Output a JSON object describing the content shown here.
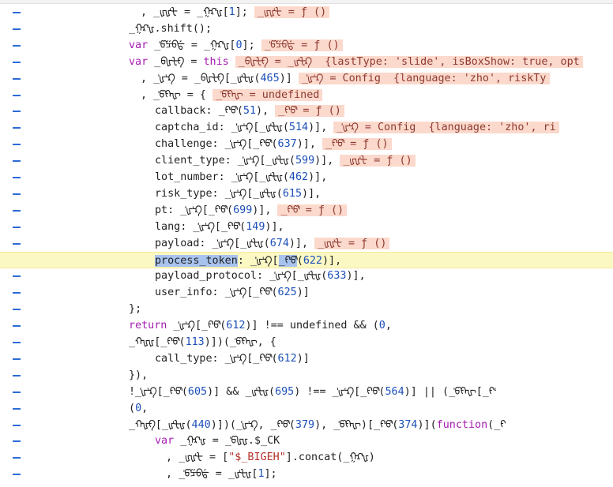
{
  "code_lines": [
    {
      "indent": 178,
      "highlight": false,
      "parts": [
        {
          "t": ", _ᡁᡁᡃᡶ = _ᠭᡘᡃᡁ[",
          "c": ""
        },
        {
          "t": "1",
          "c": "num"
        },
        {
          "t": "];",
          "c": ""
        }
      ],
      "inline": "_ᡁᡁᡃᡶ = ƒ ()"
    },
    {
      "indent": 163,
      "highlight": false,
      "parts": [
        {
          "t": "_ᠭᡘᡃᡁ.shift();",
          "c": ""
        }
      ],
      "inline": ""
    },
    {
      "indent": 163,
      "highlight": false,
      "parts": [
        {
          "t": "var",
          "c": "kw"
        },
        {
          "t": " _ᡃᡦᡸᠪᡩ = _ᠭᡘᡃᡁ[",
          "c": ""
        },
        {
          "t": "0",
          "c": "num"
        },
        {
          "t": "];",
          "c": ""
        }
      ],
      "inline": "_ᡃᡦᡸᠪᡩ = ƒ ()"
    },
    {
      "indent": 163,
      "highlight": false,
      "parts": [
        {
          "t": "var",
          "c": "kw"
        },
        {
          "t": " _ᠪᡁᡶᠻ = ",
          "c": ""
        },
        {
          "t": "this",
          "c": "kw"
        }
      ],
      "inline": "_ᠪᡁᡶᠻ = _ᡁᡃᡶᡘ  {lastType: 'slide', isBoxShow: true, opt"
    },
    {
      "indent": 178,
      "highlight": false,
      "parts": [
        {
          "t": ", _ᡃᡃᡁᡃᡘ = _ᠪᡁᡶᠻ[_ᡁᡃᡶᡁ(",
          "c": ""
        },
        {
          "t": "465",
          "c": "num"
        },
        {
          "t": ")]",
          "c": ""
        }
      ],
      "inline": "_ᡃᡃᡁᡃᡘ = Config  {language: 'zho', riskTy"
    },
    {
      "indent": 178,
      "highlight": false,
      "parts": [
        {
          "t": ", _ᡃᡦᠻᡙ = {",
          "c": ""
        }
      ],
      "inline": "_ᡃᡦᠻᡙ = undefined"
    },
    {
      "indent": 196,
      "highlight": false,
      "parts": [
        {
          "t": "callback: _ᠻᡃᡦᡃ(",
          "c": ""
        },
        {
          "t": "51",
          "c": "num"
        },
        {
          "t": "),",
          "c": ""
        }
      ],
      "inline": "_ᠻᡃᡦᡃ = ƒ ()"
    },
    {
      "indent": 196,
      "highlight": false,
      "parts": [
        {
          "t": "captcha_id: _ᡃᡃᡁᡃᡘ[_ᡁᡃᡶᡁ(",
          "c": ""
        },
        {
          "t": "514",
          "c": "num"
        },
        {
          "t": ")],",
          "c": ""
        }
      ],
      "inline": "_ᡃᡃᡁᡃᡘ = Config  {language: 'zho', ri"
    },
    {
      "indent": 196,
      "highlight": false,
      "parts": [
        {
          "t": "challenge: _ᡃᡃᡁᡃᡘ[_ᠻᡃᡦᡃ(",
          "c": ""
        },
        {
          "t": "637",
          "c": "num"
        },
        {
          "t": ")],",
          "c": ""
        }
      ],
      "inline": "_ᠻᡃᡦᡃ = ƒ ()"
    },
    {
      "indent": 196,
      "highlight": false,
      "parts": [
        {
          "t": "client_type: _ᡃᡃᡁᡃᡘ[_ᡁᡃᡶᡁ(",
          "c": ""
        },
        {
          "t": "599",
          "c": "num"
        },
        {
          "t": ")],",
          "c": ""
        }
      ],
      "inline": "_ᡁᡁᡃᡶ = ƒ ()"
    },
    {
      "indent": 196,
      "highlight": false,
      "parts": [
        {
          "t": "lot_number: _ᡃᡃᡁᡃᡘ[_ᡁᡃᡶᡁ(",
          "c": ""
        },
        {
          "t": "462",
          "c": "num"
        },
        {
          "t": ")],",
          "c": ""
        }
      ],
      "inline": ""
    },
    {
      "indent": 196,
      "highlight": false,
      "parts": [
        {
          "t": "risk_type: _ᡃᡃᡁᡃᡘ[_ᡁᡃᡶᡁ(",
          "c": ""
        },
        {
          "t": "615",
          "c": "num"
        },
        {
          "t": ")],",
          "c": ""
        }
      ],
      "inline": ""
    },
    {
      "indent": 196,
      "highlight": false,
      "parts": [
        {
          "t": "pt: _ᡃᡃᡁᡃᡘ[_ᠻᡃᡦᡃ(",
          "c": ""
        },
        {
          "t": "699",
          "c": "num"
        },
        {
          "t": ")],",
          "c": ""
        }
      ],
      "inline": "_ᠻᡃᡦᡃ = ƒ ()"
    },
    {
      "indent": 196,
      "highlight": false,
      "parts": [
        {
          "t": "lang: _ᡃᡃᡁᡃᡘ[_ᠻᡃᡦᡃ(",
          "c": ""
        },
        {
          "t": "149",
          "c": "num"
        },
        {
          "t": ")],",
          "c": ""
        }
      ],
      "inline": ""
    },
    {
      "indent": 196,
      "highlight": false,
      "parts": [
        {
          "t": "payload: _ᡃᡃᡁᡃᡘ[_ᡁᡃᡶᡁ(",
          "c": ""
        },
        {
          "t": "674",
          "c": "num"
        },
        {
          "t": ")],",
          "c": ""
        }
      ],
      "inline": "_ᡁᡁᡃᡶ = ƒ ()"
    },
    {
      "indent": 196,
      "highlight": true,
      "parts": [
        {
          "t": "process_token",
          "c": "sel"
        },
        {
          "t": ": _ᡃᡃᡁᡃᡘ[",
          "c": ""
        },
        {
          "t": "_ᠻᡃᡦᡃ",
          "c": "sel"
        },
        {
          "t": "(",
          "c": ""
        },
        {
          "t": "622",
          "c": "num"
        },
        {
          "t": ")],",
          "c": ""
        }
      ],
      "inline": ""
    },
    {
      "indent": 196,
      "highlight": false,
      "parts": [
        {
          "t": "payload_protocol: _ᡃᡃᡁᡃᡘ[_ᡁᡃᡶᡁ(",
          "c": ""
        },
        {
          "t": "633",
          "c": "num"
        },
        {
          "t": ")],",
          "c": ""
        }
      ],
      "inline": ""
    },
    {
      "indent": 196,
      "highlight": false,
      "parts": [
        {
          "t": "user_info: _ᡃᡃᡁᡃᡘ[_ᠻᡃᡦᡃ(",
          "c": ""
        },
        {
          "t": "625",
          "c": "num"
        },
        {
          "t": ")]",
          "c": ""
        }
      ],
      "inline": ""
    },
    {
      "indent": 163,
      "highlight": false,
      "parts": [
        {
          "t": "};",
          "c": ""
        }
      ],
      "inline": ""
    },
    {
      "indent": 163,
      "highlight": false,
      "parts": [
        {
          "t": "return",
          "c": "kw"
        },
        {
          "t": " _ᡃᡃᡁᡃᡘ[_ᠻᡃᡦᡃ(",
          "c": ""
        },
        {
          "t": "612",
          "c": "num"
        },
        {
          "t": ")] !== undefined && (",
          "c": ""
        },
        {
          "t": "0",
          "c": "num"
        },
        {
          "t": ",",
          "c": ""
        }
      ],
      "inline": ""
    },
    {
      "indent": 163,
      "highlight": false,
      "parts": [
        {
          "t": "_ᡣᡁᡁ[_ᠻᡃᡦᡃ(",
          "c": ""
        },
        {
          "t": "113",
          "c": "num"
        },
        {
          "t": ")])(_ᡃᡦᠻᡙ, {",
          "c": ""
        }
      ],
      "inline": ""
    },
    {
      "indent": 196,
      "highlight": false,
      "parts": [
        {
          "t": "call_type: _ᡃᡃᡁᡃᡘ[_ᠻᡃᡦᡃ(",
          "c": ""
        },
        {
          "t": "612",
          "c": "num"
        },
        {
          "t": ")]",
          "c": ""
        }
      ],
      "inline": ""
    },
    {
      "indent": 163,
      "highlight": false,
      "parts": [
        {
          "t": "}),",
          "c": ""
        }
      ],
      "inline": ""
    },
    {
      "indent": 163,
      "highlight": false,
      "parts": [
        {
          "t": "!_ᡃᡃᡁᡃᡘ[_ᠻᡃᡦᡃ(",
          "c": ""
        },
        {
          "t": "605",
          "c": "num"
        },
        {
          "t": ")] && _ᡁᡃᡶᡁ(",
          "c": ""
        },
        {
          "t": "695",
          "c": "num"
        },
        {
          "t": ") !== _ᡃᡃᡁᡃᡘ[_ᠻᡃᡦᡃ(",
          "c": ""
        },
        {
          "t": "564",
          "c": "num"
        },
        {
          "t": ")] || (_ᡃᡦᠻᡙ[_ᠻᡃ",
          "c": ""
        }
      ],
      "inline": ""
    },
    {
      "indent": 163,
      "highlight": false,
      "parts": [
        {
          "t": "(",
          "c": ""
        },
        {
          "t": "0",
          "c": "num"
        },
        {
          "t": ",",
          "c": ""
        }
      ],
      "inline": ""
    },
    {
      "indent": 163,
      "highlight": false,
      "parts": [
        {
          "t": "_ᡣᡁᠻ[_ᡁᡃᡶᡁ(",
          "c": ""
        },
        {
          "t": "440",
          "c": "num"
        },
        {
          "t": ")])(_ᡃᡃᡁᡃᡘ, _ᠻᡃᡦᡃ(",
          "c": ""
        },
        {
          "t": "379",
          "c": "num"
        },
        {
          "t": "), _ᡃᡦᠻᡙ)[_ᠻᡃᡦᡃ(",
          "c": ""
        },
        {
          "t": "374",
          "c": "num"
        },
        {
          "t": ")](",
          "c": ""
        },
        {
          "t": "function",
          "c": "kw"
        },
        {
          "t": "(_ᠻ",
          "c": ""
        }
      ],
      "inline": ""
    },
    {
      "indent": 196,
      "highlight": false,
      "parts": [
        {
          "t": "var",
          "c": "kw"
        },
        {
          "t": " _ᠭᡘᡃᡁ = _ᡃᡦᡁᡁ.$_CK",
          "c": ""
        }
      ],
      "inline": ""
    },
    {
      "indent": 210,
      "highlight": false,
      "parts": [
        {
          "t": ", _ᡁᡁᡃᡶ = [",
          "c": ""
        },
        {
          "t": "\"$_BIGEH\"",
          "c": "str"
        },
        {
          "t": "].concat(_ᠭᡘᡃᡁ)",
          "c": ""
        }
      ],
      "inline": ""
    },
    {
      "indent": 210,
      "highlight": false,
      "parts": [
        {
          "t": ", _ᡃᡦᡸᠪᡩ = _ᡁᡃᡶᡁ[",
          "c": ""
        },
        {
          "t": "1",
          "c": "num"
        },
        {
          "t": "];",
          "c": ""
        }
      ],
      "inline": ""
    }
  ]
}
